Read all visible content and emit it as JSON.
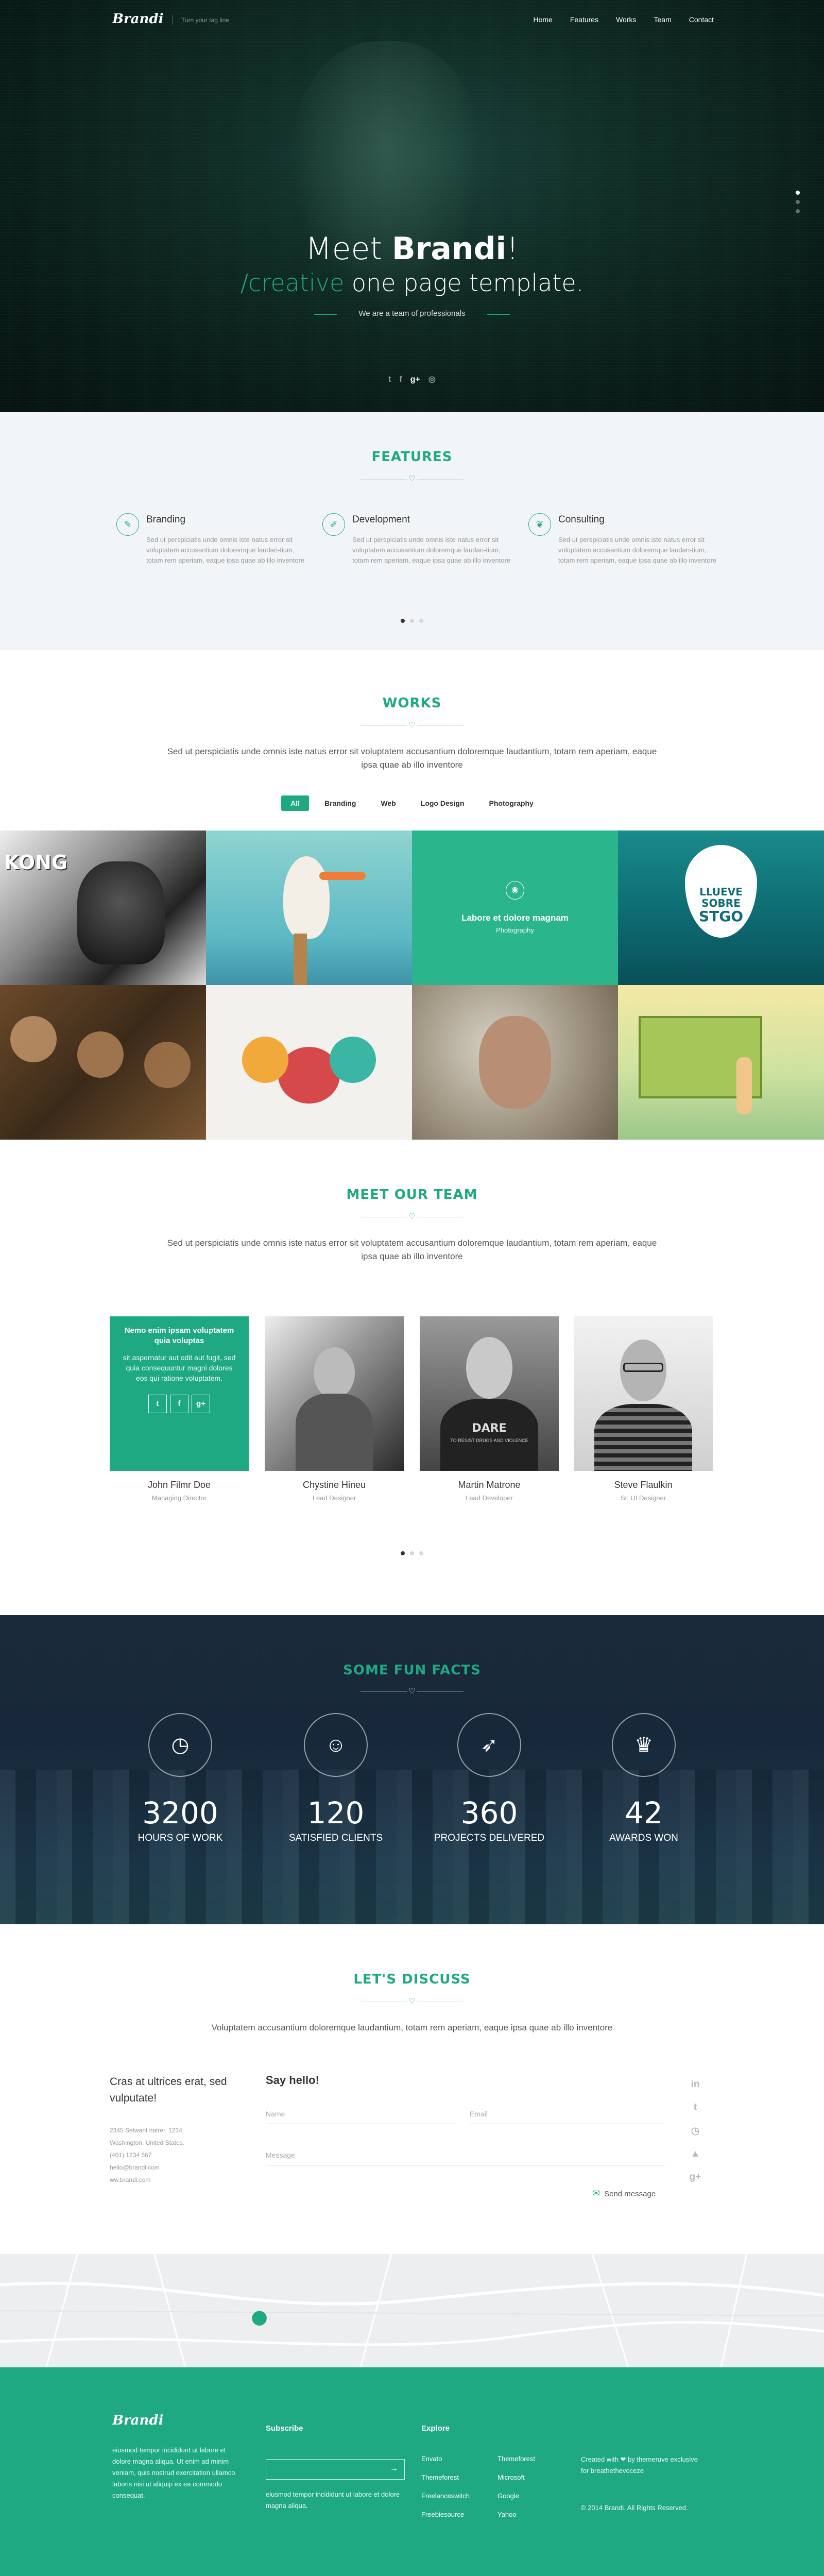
{
  "header": {
    "logo": "Brandi",
    "tagline": "Turn your tag line",
    "nav": [
      "Home",
      "Features",
      "Works",
      "Team",
      "Contact"
    ]
  },
  "hero": {
    "title_pre": "Meet ",
    "title_bold": "Brandi",
    "title_post": "!",
    "sub_accent": "/creative",
    "sub_rest": " one page template.",
    "tagline": "We are a team of professionals",
    "social": [
      "twitter-icon",
      "facebook-icon",
      "google-plus-icon",
      "dribbble-icon"
    ]
  },
  "features": {
    "title": "FEATURES",
    "items": [
      {
        "icon": "brush-icon",
        "title": "Branding",
        "desc": "Sed ut perspiciatis unde omnis iste natus error sit voluptatem accusantium doloremque laudan-tium, totam rem aperiam, eaque ipsa quae ab illo inventore"
      },
      {
        "icon": "pen-icon",
        "title": "Development",
        "desc": "Sed ut perspiciatis unde omnis iste natus error sit voluptatem accusantium doloremque laudan-tium, totam rem aperiam, eaque ipsa quae ab illo inventore"
      },
      {
        "icon": "leaf-icon",
        "title": "Consulting",
        "desc": "Sed ut perspiciatis unde omnis iste natus error sit voluptatem accusantium doloremque laudan-tium, totam rem aperiam, eaque ipsa quae ab illo inventore"
      }
    ]
  },
  "works": {
    "title": "WORKS",
    "subtitle": "Sed ut perspiciatis unde omnis iste natus error sit voluptatem accusantium doloremque laudantium, totam rem aperiam, eaque ipsa quae ab illo inventore",
    "filters": [
      "All",
      "Branding",
      "Web",
      "Logo Design",
      "Photography"
    ],
    "active_filter": "All",
    "hover": {
      "title": "Labore et dolore magnam",
      "category": "Photography"
    },
    "drop_text": [
      "LLUEVE",
      "SOBRE",
      "STGO"
    ],
    "kong_text": "KONG"
  },
  "team": {
    "title": "MEET OUR TEAM",
    "subtitle": "Sed ut perspiciatis unde omnis iste natus error sit voluptatem accusantium doloremque laudantium, totam rem aperiam, eaque ipsa quae ab illo inventore",
    "overlay": {
      "heading": "Nemo enim ipsam voluptatem quia voluptas",
      "text": "sit aspernatur aut odit aut fugit, sed quia consequuntur magni dolores eos qui ratione voluptatem.",
      "social": [
        "t",
        "f",
        "g+"
      ]
    },
    "members": [
      {
        "name": "John Filmr Doe",
        "role": "Managing Director"
      },
      {
        "name": "Chystine Hineu",
        "role": "Lead Designer"
      },
      {
        "name": "Martin Matrone",
        "role": "Lead Developer"
      },
      {
        "name": "Steve Flaulkin",
        "role": "Sr. UI Designer"
      }
    ],
    "shirt_text": "DARE",
    "shirt_sub": "TO RESIST DRUGS AND VIOLENCE"
  },
  "facts": {
    "title": "SOME FUN FACTS",
    "items": [
      {
        "icon": "clock-icon",
        "number": "3200",
        "label": "HOURS OF WORK"
      },
      {
        "icon": "user-icon",
        "number": "120",
        "label": "SATISFIED CLIENTS"
      },
      {
        "icon": "rocket-icon",
        "number": "360",
        "label": "PROJECTS DELIVERED"
      },
      {
        "icon": "trophy-icon",
        "number": "42",
        "label": "AWARDS WON"
      }
    ]
  },
  "contact": {
    "title": "LET'S DISCUSS",
    "subtitle": "Voluptatem accusantium doloremque laudantium, totam rem aperiam, eaque ipsa quae ab illo inventore",
    "lead": "Cras at ultrices erat, sed vulputate!",
    "address": [
      "2345 Setwant natrer, 1234,",
      "Washington. United States.",
      "(401) 1234 567",
      "hello@brandi.com",
      "ww.brandi.com"
    ],
    "form_title": "Say hello!",
    "name_ph": "Name",
    "email_ph": "Email",
    "message_ph": "Message",
    "send": "Send message",
    "social": [
      "in",
      "t",
      "◷",
      "▲",
      "g+"
    ]
  },
  "footer": {
    "logo": "Brandi",
    "about": "eiusmod tempor incididunt ut labore et dolore magna aliqua. Ut enim ad minim veniam, quis nostrud exercitation ullamco laboris nisi ut aliquip ex ea commodo consequat.",
    "subscribe_title": "Subscribe",
    "subscribe_text": "eiusmod tempor incididunt ut labore et dolore magna aliqua.",
    "explore_title": "Explore",
    "explore_col1": [
      "Envato",
      "Themeforest",
      "Freelanceswitch",
      "Freebiesource"
    ],
    "explore_col2": [
      "Themeforest",
      "Microsoft",
      "Google",
      "Yahoo"
    ],
    "created": "Created with ❤ by themeruve exclusive for breathethevoceze",
    "copyright": "© 2014 Brandi. All Rights Reserved."
  }
}
